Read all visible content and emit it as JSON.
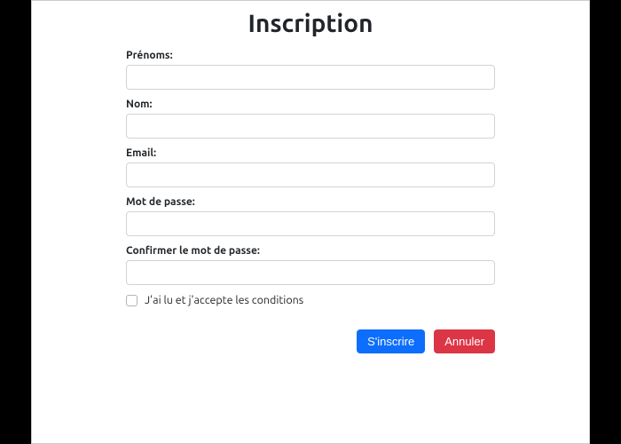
{
  "title": "Inscription",
  "fields": {
    "firstname": {
      "label": "Prénoms:",
      "value": ""
    },
    "lastname": {
      "label": "Nom:",
      "value": ""
    },
    "email": {
      "label": "Email:",
      "value": ""
    },
    "password": {
      "label": "Mot de passe:",
      "value": ""
    },
    "confirm": {
      "label": "Confirmer le mot de passe:",
      "value": ""
    }
  },
  "terms": {
    "label": "J'ai lu et j'accepte les conditions",
    "checked": false
  },
  "buttons": {
    "submit": "S'inscrire",
    "cancel": "Annuler"
  }
}
